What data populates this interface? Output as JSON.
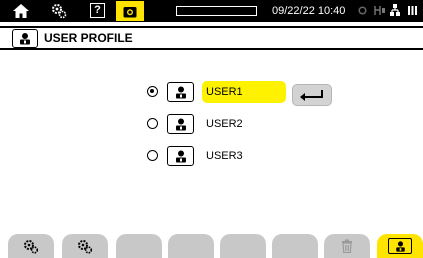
{
  "statusbar": {
    "icons": [
      "home-icon",
      "settings-icon",
      "help-icon",
      "camera-icon",
      "memory-icon",
      "connection-icon",
      "usb-icon",
      "battery-icon"
    ],
    "help_label": "?",
    "datetime": "09/22/22 10:40",
    "memory_used_fraction": 0.0
  },
  "page": {
    "title": "USER PROFILE",
    "title_icon": "user-icon"
  },
  "users": [
    {
      "label": "USER1",
      "selected": true
    },
    {
      "label": "USER2",
      "selected": false
    },
    {
      "label": "USER3",
      "selected": false
    }
  ],
  "enter_button": {
    "icon": "enter-icon"
  },
  "bottom_tabs": [
    {
      "icon": "settings-icon",
      "active": false
    },
    {
      "icon": "settings-icon",
      "active": false
    },
    {
      "icon": "",
      "active": false
    },
    {
      "icon": "",
      "active": false
    },
    {
      "icon": "",
      "active": false
    },
    {
      "icon": "",
      "active": false
    },
    {
      "icon": "trash-icon",
      "active": false
    },
    {
      "icon": "user-icon",
      "active": true
    }
  ],
  "colors": {
    "accent_yellow": "#ffe400",
    "selected_highlight": "#fff200",
    "tab_gray": "#c8c8c8"
  }
}
